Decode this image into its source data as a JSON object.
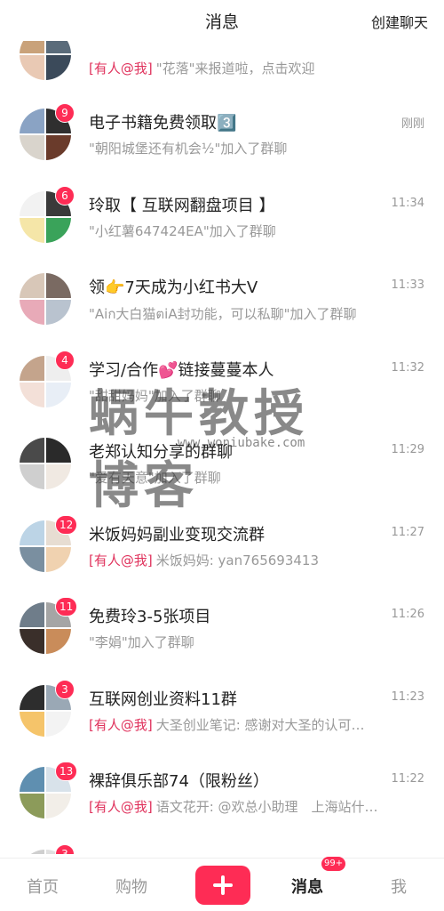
{
  "header": {
    "title": "消息",
    "create_chat": "创建聊天"
  },
  "rows": [
    {
      "name": "",
      "time": "",
      "mention": "[有人@我]",
      "preview": "\"花落\"来报道啦，点击欢迎",
      "badge": "",
      "colors": [
        "#c9a27a",
        "#5a6b7a",
        "#e9c9b4",
        "#3b4a5a"
      ]
    },
    {
      "name": "电子书籍免费领取3️⃣",
      "time": "刚刚",
      "mention": "",
      "preview": "\"朝阳城堡还有机会½\"加入了群聊",
      "badge": "9",
      "colors": [
        "#8aa3c4",
        "#2f2f2f",
        "#d9d4cc",
        "#6a3b2b"
      ]
    },
    {
      "name": "玲取【 互联网翻盘项目 】",
      "time": "11:34",
      "mention": "",
      "preview": "\"小红薯647424EA\"加入了群聊",
      "badge": "6",
      "colors": [
        "#f2f2f2",
        "#3a3a3a",
        "#f5e6a8",
        "#3aa35a"
      ]
    },
    {
      "name": "领👉7天成为小红书大V",
      "time": "11:33",
      "mention": "",
      "preview": "\"Aiก大白猫ตiA封功能，可以私聊\"加入了群聊",
      "badge": "",
      "colors": [
        "#d8c7b8",
        "#7a6a62",
        "#e8aab8",
        "#b9c3cf"
      ]
    },
    {
      "name": "学习/合作💕链接蔓蔓本人",
      "time": "11:32",
      "mention": "",
      "preview": "\"甜甜妈妈\"加入了群聊",
      "badge": "4",
      "colors": [
        "#c4a48c",
        "#eeeeee",
        "#f3e0d8",
        "#e8eef6"
      ]
    },
    {
      "name": "老郑认知分享的群聊",
      "time": "11:29",
      "mention": "",
      "preview": "\"爱有天意\"加入了群聊",
      "badge": "",
      "colors": [
        "#4a4a4a",
        "#2a2a2a",
        "#cfcfcf",
        "#f0e9e2"
      ]
    },
    {
      "name": "米饭妈妈副业变现交流群",
      "time": "11:27",
      "mention": "[有人@我]",
      "preview": "米饭妈妈: yan765693413",
      "badge": "12",
      "colors": [
        "#bcd4e6",
        "#e7ddd2",
        "#7a8fa0",
        "#f0d2b0"
      ]
    },
    {
      "name": "免费玲3-5张项目",
      "time": "11:26",
      "mention": "",
      "preview": "\"李娟\"加入了群聊",
      "badge": "11",
      "colors": [
        "#6f7d8a",
        "#a5a5a5",
        "#3a2f2a",
        "#c98c5a"
      ]
    },
    {
      "name": "互联网创业资料11群",
      "time": "11:23",
      "mention": "[有人@我]",
      "preview": "大圣创业笔记: 感谢对大圣的认可…",
      "badge": "3",
      "colors": [
        "#2d2d2d",
        "#9aa8b5",
        "#f5c46a",
        "#f3f3f3"
      ]
    },
    {
      "name": "裸辞俱乐部74（限粉丝）",
      "time": "11:22",
      "mention": "[有人@我]",
      "preview": "语文花开: @欢总小助理　上海站什…",
      "badge": "13",
      "colors": [
        "#5f8fb0",
        "#d8e2ea",
        "#8c9b5a",
        "#f2eee8"
      ]
    },
    {
      "name": "",
      "time": "",
      "mention": "",
      "preview": "",
      "badge": "3",
      "colors": [
        "#cfcfcf",
        "#e0e0e0",
        "#eeeeee",
        "#e5e5e5"
      ]
    }
  ],
  "watermark": {
    "text": "蜗牛教授博客",
    "url": "www.woniubake.com"
  },
  "tabbar": {
    "home": "首页",
    "shop": "购物",
    "messages": "消息",
    "messages_badge": "99+",
    "me": "我"
  }
}
